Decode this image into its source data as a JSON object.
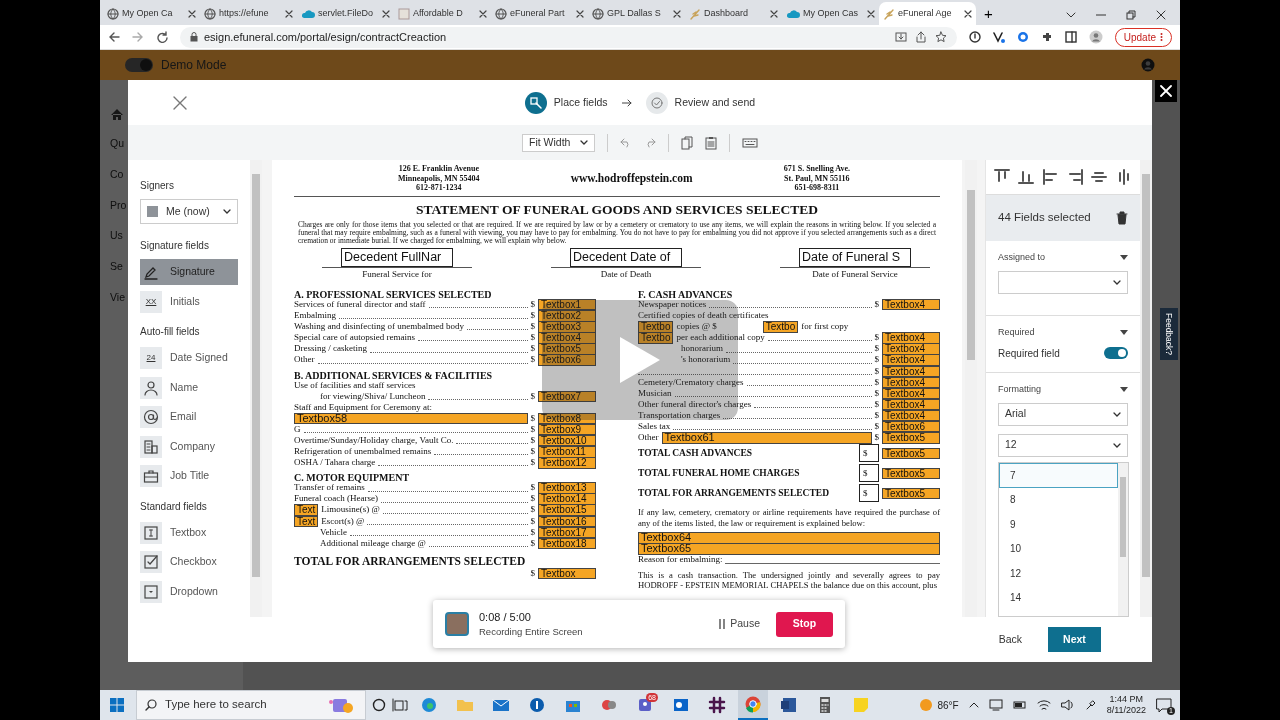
{
  "browser": {
    "tabs": [
      {
        "title": "My Open Ca",
        "kind": "globe",
        "selected": false
      },
      {
        "title": "https://efune",
        "kind": "globe",
        "selected": false
      },
      {
        "title": "servlet.FileDo",
        "kind": "cloud",
        "selected": false
      },
      {
        "title": "Affordable D",
        "kind": "page",
        "selected": false
      },
      {
        "title": "eFuneral Part",
        "kind": "globe",
        "selected": false
      },
      {
        "title": "GPL Dallas S",
        "kind": "globe",
        "selected": false
      },
      {
        "title": "Dashboard",
        "kind": "spark",
        "selected": false
      },
      {
        "title": "My Open Cas",
        "kind": "cloud",
        "selected": false
      },
      {
        "title": "eFuneral Age",
        "kind": "spark",
        "selected": true
      }
    ],
    "new_tab": "+",
    "url": "esign.efuneral.com/portal/esign/contractCreaction",
    "update_button": "Update"
  },
  "app_background": {
    "demo_mode": {
      "label": "Demo Mode",
      "on": true
    },
    "nav_items": [
      "Qu",
      "Co",
      "Pro",
      "Us",
      "Se",
      "Vie"
    ]
  },
  "modal": {
    "steps": [
      {
        "label": "Place fields",
        "selected": true
      },
      {
        "label": "Review and send",
        "selected": false
      }
    ],
    "zoom_select": "Fit Width",
    "left_panel": {
      "signers_label": "Signers",
      "signer": "Me (now)",
      "groups": [
        {
          "title": "Signature fields",
          "items": [
            {
              "label": "Signature",
              "kind": "pen",
              "selected": true
            },
            {
              "label": "Initials",
              "kind": "glyph",
              "glyph": "XX",
              "selected": false
            }
          ]
        },
        {
          "title": "Auto-fill fields",
          "items": [
            {
              "label": "Date Signed",
              "kind": "glyph",
              "glyph": "24",
              "selected": false
            },
            {
              "label": "Name",
              "kind": "person",
              "selected": false
            },
            {
              "label": "Email",
              "kind": "at",
              "selected": false
            },
            {
              "label": "Company",
              "kind": "building",
              "selected": false
            },
            {
              "label": "Job Title",
              "kind": "briefcase",
              "selected": false
            }
          ]
        },
        {
          "title": "Standard fields",
          "items": [
            {
              "label": "Textbox",
              "kind": "textbox",
              "selected": false
            },
            {
              "label": "Checkbox",
              "kind": "checkbox",
              "selected": false
            },
            {
              "label": "Dropdown",
              "kind": "dropdown",
              "selected": false
            }
          ]
        }
      ]
    },
    "document": {
      "left_address": [
        "126 E. Franklin Avenue",
        "Minneapolis, MN 55404",
        "612-871-1234"
      ],
      "website": "www.hodroffepstein.com",
      "right_address": [
        "671 S. Snelling Ave.",
        "St. Paul, MN 55116",
        "651-698-8311"
      ],
      "title": "STATEMENT OF FUNERAL GOODS AND SERVICES SELECTED",
      "notice": "Charges are only for those items that you selected or that are required. If we are required by law or by a cemetery or crematory to use any items, we will explain the reasons in writing below. If you selected a funeral that may require embalming, such as a funeral with viewing, you may have to pay for embalming. You do not have to pay for embalming you did not approve if you selected arrangements such as a direct cremation or immediate burial. If we charged for embalming, we will explain why below.",
      "top_fields": [
        {
          "value": "Decedent FullNar",
          "caption": "Funeral Service for"
        },
        {
          "value": "Decedent Date of",
          "caption": "Date of Death"
        },
        {
          "value": "Date of Funeral S",
          "caption": "Date of Funeral Service"
        }
      ],
      "left_column": [
        {
          "kind": "heading",
          "text": "A. PROFESSIONAL SERVICES SELECTED"
        },
        {
          "kind": "row",
          "parts": [
            {
              "kind": "text",
              "text": "Services of funeral director and staff"
            },
            {
              "kind": "dots"
            },
            {
              "kind": "text",
              "text": "$"
            },
            {
              "kind": "field",
              "text": "Textbox1"
            }
          ]
        },
        {
          "kind": "row",
          "parts": [
            {
              "kind": "text",
              "text": "Embalming"
            },
            {
              "kind": "dots"
            },
            {
              "kind": "text",
              "text": "$"
            },
            {
              "kind": "field",
              "text": "Textbox2"
            }
          ]
        },
        {
          "kind": "row",
          "parts": [
            {
              "kind": "text",
              "text": "Washing and disinfecting of unembalmed body"
            },
            {
              "kind": "dots"
            },
            {
              "kind": "text",
              "text": "$"
            },
            {
              "kind": "field",
              "text": "Textbox3"
            }
          ]
        },
        {
          "kind": "row",
          "parts": [
            {
              "kind": "text",
              "text": "Special care of autopsied remains"
            },
            {
              "kind": "dots"
            },
            {
              "kind": "text",
              "text": "$"
            },
            {
              "kind": "field",
              "text": "Textbox4"
            }
          ]
        },
        {
          "kind": "row",
          "parts": [
            {
              "kind": "text",
              "text": "Dressing / casketing"
            },
            {
              "kind": "dots"
            },
            {
              "kind": "text",
              "text": "$"
            },
            {
              "kind": "field",
              "text": "Textbox5"
            }
          ]
        },
        {
          "kind": "row",
          "parts": [
            {
              "kind": "text",
              "text": "Other"
            },
            {
              "kind": "dots"
            },
            {
              "kind": "text",
              "text": "$"
            },
            {
              "kind": "field",
              "text": "Textbox6"
            }
          ]
        },
        {
          "kind": "heading",
          "text": "B. ADDITIONAL SERVICES & FACILITIES"
        },
        {
          "kind": "row",
          "parts": [
            {
              "kind": "text",
              "text": "Use of facilities and staff services"
            }
          ]
        },
        {
          "kind": "row",
          "indent": true,
          "parts": [
            {
              "kind": "text",
              "text": "for viewing/Shiva/ Luncheon"
            },
            {
              "kind": "dots"
            },
            {
              "kind": "text",
              "text": "$"
            },
            {
              "kind": "field",
              "text": "Textbox7"
            }
          ]
        },
        {
          "kind": "row",
          "parts": [
            {
              "kind": "text",
              "text": "Staff and Equipment for Ceremony at:"
            }
          ]
        },
        {
          "kind": "row",
          "parts": [
            {
              "kind": "wide",
              "text": "Textbox58"
            },
            {
              "kind": "text",
              "text": "$"
            },
            {
              "kind": "field",
              "text": "Textbox8"
            }
          ]
        },
        {
          "kind": "row",
          "parts": [
            {
              "kind": "text",
              "text": "G"
            },
            {
              "kind": "dots"
            },
            {
              "kind": "text",
              "text": "$"
            },
            {
              "kind": "field",
              "text": "Textbox9"
            }
          ]
        },
        {
          "kind": "row",
          "parts": [
            {
              "kind": "text",
              "text": "Overtime/Sunday/Holiday charge, Vault Co."
            },
            {
              "kind": "dots"
            },
            {
              "kind": "text",
              "text": "$"
            },
            {
              "kind": "field",
              "text": "Textbox10"
            }
          ]
        },
        {
          "kind": "row",
          "parts": [
            {
              "kind": "text",
              "text": "Refrigeration of unembalmed remains"
            },
            {
              "kind": "dots"
            },
            {
              "kind": "text",
              "text": "$"
            },
            {
              "kind": "field",
              "text": "Textbox11"
            }
          ]
        },
        {
          "kind": "row",
          "parts": [
            {
              "kind": "text",
              "text": "OSHA / Tahara charge"
            },
            {
              "kind": "dots"
            },
            {
              "kind": "text",
              "text": "$"
            },
            {
              "kind": "field",
              "text": "Textbox12"
            }
          ]
        },
        {
          "kind": "heading",
          "text": "C. MOTOR EQUIPMENT"
        },
        {
          "kind": "row",
          "parts": [
            {
              "kind": "text",
              "text": "Transfer of remains"
            },
            {
              "kind": "dots"
            },
            {
              "kind": "text",
              "text": "$"
            },
            {
              "kind": "field",
              "text": "Textbox13"
            }
          ]
        },
        {
          "kind": "row",
          "parts": [
            {
              "kind": "text",
              "text": "Funeral coach (Hearse)"
            },
            {
              "kind": "dots"
            },
            {
              "kind": "text",
              "text": "$"
            },
            {
              "kind": "field",
              "text": "Textbox14"
            }
          ]
        },
        {
          "kind": "row",
          "parts": [
            {
              "kind": "small",
              "text": "Text"
            },
            {
              "kind": "text",
              "text": "Limousine(s) @"
            },
            {
              "kind": "dots"
            },
            {
              "kind": "text",
              "text": "$"
            },
            {
              "kind": "field",
              "text": "Textbox15"
            }
          ]
        },
        {
          "kind": "row",
          "parts": [
            {
              "kind": "small",
              "text": "Text"
            },
            {
              "kind": "text",
              "text": "Escort(s) @"
            },
            {
              "kind": "dots"
            },
            {
              "kind": "text",
              "text": "$"
            },
            {
              "kind": "field",
              "text": "Textbox16"
            }
          ]
        },
        {
          "kind": "row",
          "indent": true,
          "parts": [
            {
              "kind": "text",
              "text": "Vehicle"
            },
            {
              "kind": "dots"
            },
            {
              "kind": "text",
              "text": "$"
            },
            {
              "kind": "field",
              "text": "Textbox17"
            }
          ]
        },
        {
          "kind": "row",
          "indent": true,
          "parts": [
            {
              "kind": "text",
              "text": "Additional mileage charge @"
            },
            {
              "kind": "dots"
            },
            {
              "kind": "text",
              "text": "$"
            },
            {
              "kind": "field",
              "text": "Textbox18"
            }
          ]
        },
        {
          "kind": "big_heading",
          "text": "TOTAL FOR ARRANGEMENTS SELECTED"
        },
        {
          "kind": "row",
          "parts": [
            {
              "kind": "space"
            },
            {
              "kind": "text",
              "text": "$"
            },
            {
              "kind": "field",
              "text": "Textbox"
            }
          ]
        }
      ],
      "right_column": [
        {
          "kind": "heading",
          "text": "F. CASH ADVANCES"
        },
        {
          "kind": "row",
          "parts": [
            {
              "kind": "text",
              "text": "Newspaper notices"
            },
            {
              "kind": "dots"
            },
            {
              "kind": "text",
              "text": "$"
            },
            {
              "kind": "field",
              "text": "Textbox4"
            }
          ]
        },
        {
          "kind": "row",
          "parts": [
            {
              "kind": "text",
              "text": "Certified copies of death certificates"
            }
          ]
        },
        {
          "kind": "row",
          "parts": [
            {
              "kind": "small",
              "text": "Textbo"
            },
            {
              "kind": "text",
              "text": "copies @ $"
            },
            {
              "kind": "blank"
            },
            {
              "kind": "small",
              "text": "Textbo"
            },
            {
              "kind": "text",
              "text": "for first copy"
            }
          ]
        },
        {
          "kind": "row",
          "parts": [
            {
              "kind": "small",
              "text": "Textbo"
            },
            {
              "kind": "text",
              "text": "per each additional copy"
            },
            {
              "kind": "dots"
            },
            {
              "kind": "text",
              "text": "$"
            },
            {
              "kind": "field",
              "text": "Textbox4"
            }
          ]
        },
        {
          "kind": "row",
          "parts": [
            {
              "kind": "blank"
            },
            {
              "kind": "text",
              "text": "honorarium"
            },
            {
              "kind": "dots"
            },
            {
              "kind": "text",
              "text": "$"
            },
            {
              "kind": "field",
              "text": "Textbox4"
            }
          ]
        },
        {
          "kind": "row",
          "parts": [
            {
              "kind": "blank"
            },
            {
              "kind": "text",
              "text": "'s honorarium"
            },
            {
              "kind": "dots"
            },
            {
              "kind": "text",
              "text": "$"
            },
            {
              "kind": "field",
              "text": "Textbox4"
            }
          ]
        },
        {
          "kind": "row",
          "parts": [
            {
              "kind": "dots"
            },
            {
              "kind": "text",
              "text": "$"
            },
            {
              "kind": "field",
              "text": "Textbox4"
            }
          ]
        },
        {
          "kind": "row",
          "parts": [
            {
              "kind": "text",
              "text": "Cemetery/Crematory charges"
            },
            {
              "kind": "dots"
            },
            {
              "kind": "text",
              "text": "$"
            },
            {
              "kind": "field",
              "text": "Textbox4"
            }
          ]
        },
        {
          "kind": "row",
          "parts": [
            {
              "kind": "text",
              "text": "Musician"
            },
            {
              "kind": "dots"
            },
            {
              "kind": "text",
              "text": "$"
            },
            {
              "kind": "field",
              "text": "Textbox4"
            }
          ]
        },
        {
          "kind": "row",
          "parts": [
            {
              "kind": "text",
              "text": "Other funeral director's charges"
            },
            {
              "kind": "dots"
            },
            {
              "kind": "text",
              "text": "$"
            },
            {
              "kind": "field",
              "text": "Textbox4"
            }
          ]
        },
        {
          "kind": "row",
          "parts": [
            {
              "kind": "text",
              "text": "Transportation charges"
            },
            {
              "kind": "dots"
            },
            {
              "kind": "text",
              "text": "$"
            },
            {
              "kind": "field",
              "text": "Textbox4"
            }
          ]
        },
        {
          "kind": "row",
          "parts": [
            {
              "kind": "text",
              "text": "Sales tax"
            },
            {
              "kind": "dots"
            },
            {
              "kind": "text",
              "text": "$"
            },
            {
              "kind": "field",
              "text": "Textbox6"
            }
          ]
        },
        {
          "kind": "row",
          "parts": [
            {
              "kind": "text",
              "text": "Other"
            },
            {
              "kind": "wide",
              "text": "Textbox61"
            },
            {
              "kind": "text",
              "text": "$"
            },
            {
              "kind": "field",
              "text": "Textbox5"
            }
          ]
        },
        {
          "kind": "total",
          "parts": [
            {
              "kind": "bold",
              "text": "TOTAL CASH ADVANCES"
            },
            {
              "kind": "space"
            },
            {
              "kind": "boxed",
              "text": "$"
            },
            {
              "kind": "field",
              "text": "Textbox5"
            }
          ]
        },
        {
          "kind": "total",
          "parts": [
            {
              "kind": "bold",
              "text": "TOTAL FUNERAL HOME CHARGES"
            },
            {
              "kind": "space"
            },
            {
              "kind": "boxed",
              "text": "$"
            },
            {
              "kind": "field",
              "text": "Textbox5"
            }
          ]
        },
        {
          "kind": "total",
          "parts": [
            {
              "kind": "bold",
              "text": "TOTAL FOR ARRANGEMENTS SELECTED"
            },
            {
              "kind": "space"
            },
            {
              "kind": "boxed",
              "text": "$"
            },
            {
              "kind": "field",
              "text": "Textbox5"
            }
          ]
        },
        {
          "kind": "paragraph",
          "text": "If any law, cemetery, crematory or airline requirements have required the purchase of any of the items listed, the law or requirement is explained below:"
        },
        {
          "kind": "row",
          "parts": [
            {
              "kind": "wide",
              "text": "Textbox64"
            }
          ]
        },
        {
          "kind": "row",
          "parts": [
            {
              "kind": "wide",
              "text": "Textbox65"
            }
          ]
        },
        {
          "kind": "row",
          "parts": [
            {
              "kind": "text",
              "text": "Reason for embalming:"
            },
            {
              "kind": "line"
            }
          ]
        },
        {
          "kind": "paragraph",
          "text": "This is a cash transaction. The undersigned jointly and severally agrees to pay HODROFF - EPSTEIN MEMORIAL CHAPELS the balance due on this account, plus"
        }
      ]
    },
    "right_panel": {
      "selection_count": "44 Fields selected",
      "assigned_label": "Assigned to",
      "required_label": "Required",
      "required_field": {
        "label": "Required field",
        "on": true
      },
      "formatting_label": "Formatting",
      "font": "Arial",
      "size": "12",
      "size_options": [
        {
          "label": "7",
          "selected": true
        },
        {
          "label": "8",
          "selected": false
        },
        {
          "label": "9",
          "selected": false
        },
        {
          "label": "10",
          "selected": false
        },
        {
          "label": "12",
          "selected": false
        },
        {
          "label": "14",
          "selected": false
        }
      ]
    },
    "back_button": "Back",
    "next_button": "Next"
  },
  "feedback_tab": "Feedback?",
  "recording": {
    "time": "0:08 / 5:00",
    "caption": "Recording Entire Screen",
    "pause": "Pause",
    "stop": "Stop"
  },
  "taskbar": {
    "search_placeholder": "Type here to search",
    "apps": [
      {
        "kind": "edge",
        "selected": false
      },
      {
        "kind": "folder",
        "selected": false
      },
      {
        "kind": "mail",
        "selected": false
      },
      {
        "kind": "key",
        "selected": false
      },
      {
        "kind": "store",
        "selected": false
      },
      {
        "kind": "tool",
        "selected": false
      },
      {
        "kind": "teams",
        "badge": "68",
        "selected": false
      },
      {
        "kind": "outlook",
        "selected": false
      },
      {
        "kind": "slack",
        "selected": false
      },
      {
        "kind": "chrome",
        "selected": true
      },
      {
        "kind": "word",
        "selected": false
      },
      {
        "kind": "calculator",
        "selected": false
      },
      {
        "kind": "notes",
        "selected": false
      }
    ],
    "temperature": "86°F",
    "time": "1:44 PM",
    "date": "8/11/2022",
    "notifications": "1"
  }
}
